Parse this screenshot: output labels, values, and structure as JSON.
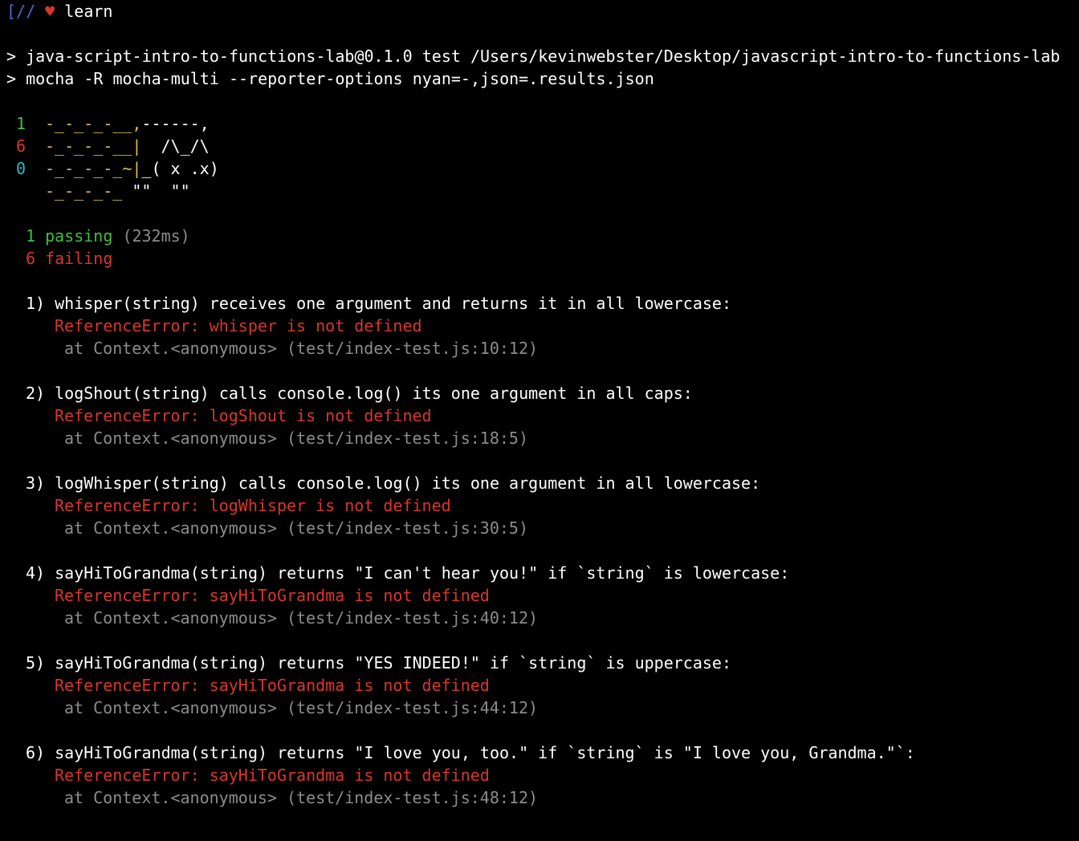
{
  "prompt": {
    "bracket": "[//",
    "heart": "♥",
    "command": "learn"
  },
  "npm": {
    "line1": "> java-script-intro-to-functions-lab@0.1.0 test /Users/kevinwebster/Desktop/javascript-intro-to-functions-lab",
    "line2": "> mocha -R mocha-multi --reporter-options nyan=-,json=.results.json"
  },
  "nyan": {
    "counts": [
      "1",
      "6",
      "0",
      ""
    ],
    "trail": [
      "-_-_-_-__,",
      "-_-_-_-__|",
      "-_-_-_-_~|",
      "-_-_-_-_ "
    ],
    "cat": [
      "------,",
      "  /\\_/\\",
      "_( x .x)",
      "\"\"  \"\""
    ]
  },
  "summary": {
    "passing_count": "1",
    "passing_label": "passing",
    "duration": "(232ms)",
    "failing_count": "6",
    "failing_label": "failing"
  },
  "failures": [
    {
      "title": "1) whisper(string) receives one argument and returns it in all lowercase:",
      "error": "ReferenceError: whisper is not defined",
      "stack_prefix": "at Context.<anonymous>",
      "stack_location": "(test/index-test.js:10:12)"
    },
    {
      "title": "2) logShout(string) calls console.log() its one argument in all caps:",
      "error": "ReferenceError: logShout is not defined",
      "stack_prefix": "at Context.<anonymous>",
      "stack_location": "(test/index-test.js:18:5)"
    },
    {
      "title": "3) logWhisper(string) calls console.log() its one argument in all lowercase:",
      "error": "ReferenceError: logWhisper is not defined",
      "stack_prefix": "at Context.<anonymous>",
      "stack_location": "(test/index-test.js:30:5)"
    },
    {
      "title": "4) sayHiToGrandma(string) returns \"I can't hear you!\" if `string` is lowercase:",
      "error": "ReferenceError: sayHiToGrandma is not defined",
      "stack_prefix": "at Context.<anonymous>",
      "stack_location": "(test/index-test.js:40:12)"
    },
    {
      "title": "5) sayHiToGrandma(string) returns \"YES INDEED!\" if `string` is uppercase:",
      "error": "ReferenceError: sayHiToGrandma is not defined",
      "stack_prefix": "at Context.<anonymous>",
      "stack_location": "(test/index-test.js:44:12)"
    },
    {
      "title": "6) sayHiToGrandma(string) returns \"I love you, too.\" if `string` is \"I love you, Grandma.\"`:",
      "error": "ReferenceError: sayHiToGrandma is not defined",
      "stack_prefix": "at Context.<anonymous>",
      "stack_location": "(test/index-test.js:48:12)"
    }
  ],
  "colors": {
    "background": "#000000",
    "text": "#ffffff",
    "passing": "#3fbf3f",
    "failing": "#d9362b",
    "skipped": "#2fb8c8",
    "trail": "#d8c04a",
    "muted": "#8c8c8c",
    "prompt_bracket": "#4a6cd4"
  }
}
